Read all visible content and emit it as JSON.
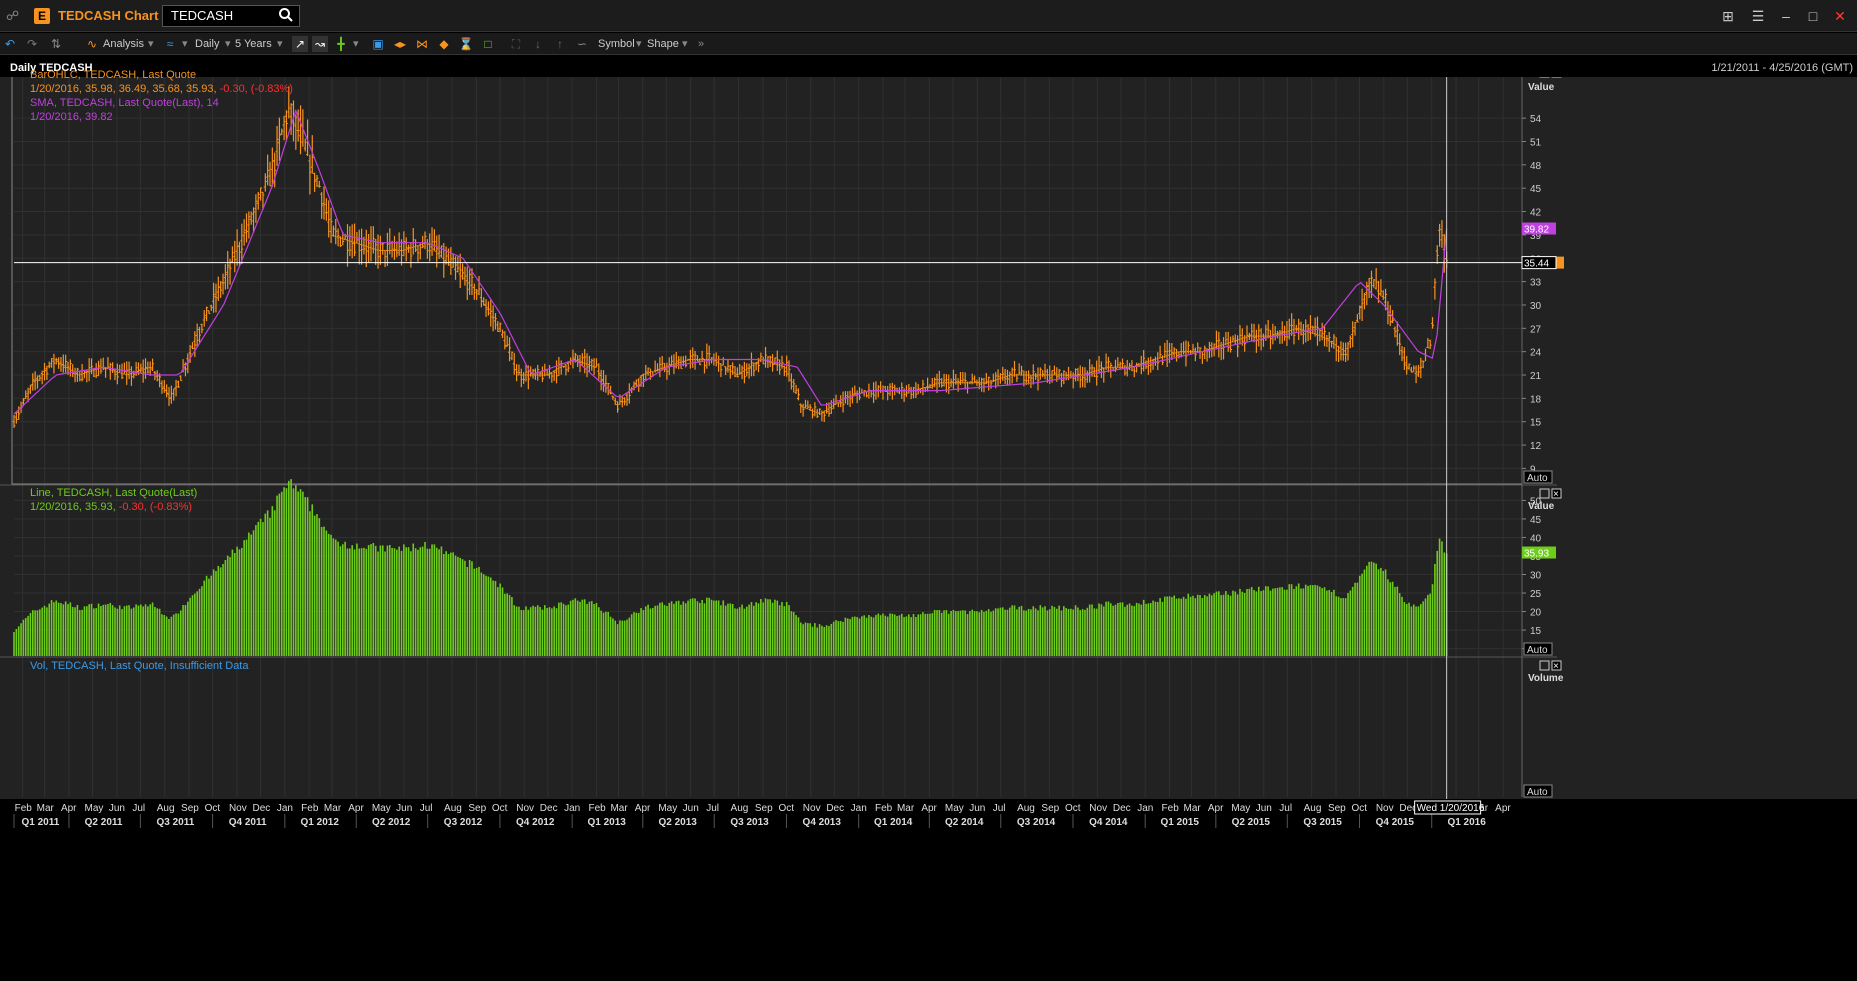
{
  "window": {
    "title": "TEDCASH Chart",
    "search_value": "TEDCASH"
  },
  "toolbar": {
    "analysis": "Analysis",
    "interval": "Daily",
    "range": "5 Years",
    "symbol": "Symbol",
    "shape": "Shape"
  },
  "subheader": {
    "title": "Daily TEDCASH",
    "date_range": "1/21/2011 - 4/25/2016 (GMT)"
  },
  "colors": {
    "ohlc": "#f7931e",
    "sma": "#c040e0",
    "line_bars": "#6ecc1a",
    "volume_legend": "#3a9ae8",
    "negative": "#ff3030",
    "background": "#222222"
  },
  "panes": {
    "price": {
      "legend": [
        "BarOHLC, TEDCASH, Last Quote",
        "1/20/2016, 35.98, 36.49, 35.68, 35.93,",
        "-0.30, (-0.83%)",
        "SMA, TEDCASH, Last Quote(Last), 14",
        "1/20/2016, 39.82"
      ],
      "axis_title": "Value",
      "ticks": [
        "54",
        "51",
        "48",
        "45",
        "42",
        "39",
        "36",
        "33",
        "30",
        "27",
        "24",
        "21",
        "18",
        "15",
        "12",
        "9"
      ],
      "sma_tag": "39.82",
      "crosshair_tag": "35.44",
      "auto_label": "Auto"
    },
    "line": {
      "legend": [
        "Line, TEDCASH, Last Quote(Last)",
        "1/20/2016, 35.93,",
        "-0.30, (-0.83%)"
      ],
      "axis_title": "Value",
      "ticks": [
        "50",
        "45",
        "40",
        "35",
        "30",
        "25",
        "20",
        "15",
        "10"
      ],
      "last_tag": "35.93",
      "auto_label": "Auto"
    },
    "volume": {
      "legend": "Vol, TEDCASH, Last Quote, Insufficient Data",
      "axis_title": "Volume",
      "auto_label": "Auto"
    }
  },
  "x_axis": {
    "months": [
      "Feb",
      "Mar",
      "Apr",
      "May",
      "Jun",
      "Jul",
      "Aug",
      "Sep",
      "Oct",
      "Nov",
      "Dec",
      "Jan",
      "Feb",
      "Mar",
      "Apr",
      "May",
      "Jun",
      "Jul",
      "Aug",
      "Sep",
      "Oct",
      "Nov",
      "Dec",
      "Jan",
      "Feb",
      "Mar",
      "Apr",
      "May",
      "Jun",
      "Jul",
      "Aug",
      "Sep",
      "Oct",
      "Nov",
      "Dec",
      "Jan",
      "Feb",
      "Mar",
      "Apr",
      "May",
      "Jun",
      "Jul",
      "Aug",
      "Sep",
      "Oct",
      "Nov",
      "Dec",
      "Jan",
      "Feb",
      "Mar",
      "Apr",
      "May",
      "Jun",
      "Jul",
      "Aug",
      "Sep",
      "Oct",
      "Nov",
      "Dec",
      "Jan",
      "Feb",
      "Mar",
      "Apr"
    ],
    "quarters": [
      "Q1 2011",
      "Q2 2011",
      "Q3 2011",
      "Q4 2011",
      "Q1 2012",
      "Q2 2012",
      "Q3 2012",
      "Q4 2012",
      "Q1 2013",
      "Q2 2013",
      "Q3 2013",
      "Q4 2013",
      "Q1 2014",
      "Q2 2014",
      "Q3 2014",
      "Q4 2014",
      "Q1 2015",
      "Q2 2015",
      "Q3 2015",
      "Q4 2015",
      "Q1 2016"
    ],
    "crosshair_date": "Wed 1/20/2016"
  },
  "chart_data": {
    "type": "line",
    "title": "Daily TEDCASH",
    "x_range": [
      "2011-01-21",
      "2016-04-25"
    ],
    "y_range_price": [
      7,
      58
    ],
    "y_range_line": [
      8,
      52
    ],
    "series": [
      {
        "name": "BarOHLC, TEDCASH, Last Quote",
        "kind": "ohlc",
        "dates": [
          "2011-01-21",
          "2011-02-15",
          "2011-03-15",
          "2011-04-15",
          "2011-05-15",
          "2011-06-15",
          "2011-07-15",
          "2011-08-10",
          "2011-09-15",
          "2011-10-15",
          "2011-11-15",
          "2011-12-15",
          "2012-01-05",
          "2012-01-20",
          "2012-02-15",
          "2012-03-01",
          "2012-04-01",
          "2012-05-01",
          "2012-06-01",
          "2012-07-01",
          "2012-08-01",
          "2012-09-01",
          "2012-10-01",
          "2012-10-25",
          "2012-12-01",
          "2013-01-05",
          "2013-02-01",
          "2013-03-01",
          "2013-04-01",
          "2013-05-01",
          "2013-06-01",
          "2013-07-01",
          "2013-08-01",
          "2013-09-01",
          "2013-10-01",
          "2013-10-20",
          "2013-11-15",
          "2013-12-15",
          "2014-01-15",
          "2014-02-15",
          "2014-03-15",
          "2014-04-15",
          "2014-05-15",
          "2014-06-15",
          "2014-07-15",
          "2014-08-15",
          "2014-09-15",
          "2014-10-15",
          "2014-11-15",
          "2014-12-15",
          "2015-01-15",
          "2015-02-15",
          "2015-03-15",
          "2015-04-15",
          "2015-05-15",
          "2015-06-15",
          "2015-07-15",
          "2015-08-15",
          "2015-09-15",
          "2015-10-15",
          "2015-11-01",
          "2015-11-15",
          "2015-12-01",
          "2015-12-15",
          "2016-01-01",
          "2016-01-10",
          "2016-01-20"
        ],
        "close": [
          15,
          20,
          23,
          21,
          22,
          21,
          22,
          18,
          27,
          33,
          40,
          47,
          55,
          52,
          45,
          39,
          38,
          37,
          37,
          38,
          35,
          32,
          27,
          21,
          21,
          23,
          22,
          17,
          21,
          22,
          23,
          23,
          21,
          23,
          22,
          17,
          16,
          18,
          19,
          19,
          19,
          20,
          20,
          20,
          21,
          21,
          21,
          21,
          22,
          22,
          23,
          24,
          24,
          25,
          26,
          26,
          27,
          26,
          24,
          33,
          31,
          27,
          22,
          21,
          26,
          40,
          35.93
        ]
      },
      {
        "name": "SMA, TEDCASH, Last Quote(Last), 14",
        "kind": "line",
        "dates": [
          "2011-01-21",
          "2011-03-15",
          "2011-05-15",
          "2011-07-15",
          "2011-08-20",
          "2011-10-15",
          "2011-12-15",
          "2012-01-15",
          "2012-02-15",
          "2012-03-15",
          "2012-05-01",
          "2012-07-01",
          "2012-08-15",
          "2012-10-01",
          "2012-11-10",
          "2013-01-05",
          "2013-03-01",
          "2013-05-01",
          "2013-07-01",
          "2013-09-01",
          "2013-10-15",
          "2013-11-15",
          "2014-01-15",
          "2014-04-15",
          "2014-08-15",
          "2014-12-15",
          "2015-03-15",
          "2015-06-15",
          "2015-08-15",
          "2015-10-01",
          "2015-11-01",
          "2015-12-15",
          "2016-01-05",
          "2016-01-20"
        ],
        "values": [
          16,
          21,
          22,
          21,
          21,
          30,
          45,
          55,
          47,
          39,
          38,
          38,
          36,
          29,
          21,
          23,
          18,
          22,
          23,
          23,
          22,
          17,
          19,
          19,
          20,
          22,
          24,
          26,
          27,
          33,
          30,
          24,
          23,
          39.82
        ]
      },
      {
        "name": "Line, TEDCASH, Last Quote(Last)",
        "kind": "bars",
        "last_value": 35.93
      }
    ]
  }
}
